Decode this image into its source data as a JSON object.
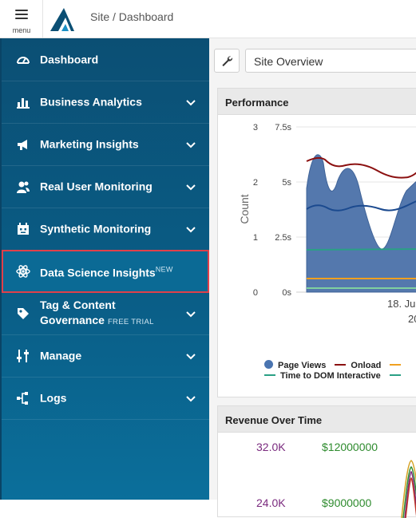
{
  "header": {
    "menu_label": "menu",
    "breadcrumb": "Site / Dashboard"
  },
  "sidebar": {
    "items": [
      {
        "label": "Dashboard",
        "icon": "gauge-icon"
      },
      {
        "label": "Business Analytics",
        "icon": "bar-chart-icon"
      },
      {
        "label": "Marketing Insights",
        "icon": "megaphone-icon"
      },
      {
        "label": "Real User Monitoring",
        "icon": "users-icon"
      },
      {
        "label": "Synthetic Monitoring",
        "icon": "robot-icon"
      },
      {
        "label": "Data Science Insights",
        "badge": "NEW",
        "icon": "atom-icon",
        "active": true
      },
      {
        "label_line1": "Tag & Content",
        "label_line2": "Governance",
        "badge": "FREE TRIAL",
        "icon": "tag-icon"
      },
      {
        "label": "Manage",
        "icon": "sliders-icon"
      },
      {
        "label": "Logs",
        "icon": "hierarchy-icon"
      }
    ]
  },
  "toolbar": {
    "site_select_value": "Site Overview"
  },
  "performance": {
    "title": "Performance",
    "y_axis_count_label": "Count",
    "y_ticks_count": [
      "3",
      "2",
      "1",
      "0"
    ],
    "y_ticks_time": [
      "7.5s",
      "5s",
      "2.5s",
      "0s"
    ],
    "x_label_partial": "18. Ju",
    "x_label_year_partial": "20",
    "legend": {
      "page_views": "Page Views",
      "onload": "Onload",
      "tti": "Time to DOM Interactive"
    }
  },
  "revenue": {
    "title": "Revenue Over Time",
    "axis_left_top": "32.0K",
    "axis_right_top": "$12000000",
    "axis_left_bottom": "24.0K",
    "axis_right_bottom": "$9000000"
  },
  "colors": {
    "sidebar": "#0b5d86",
    "highlight": "#e0404a",
    "page_views": "#4a74b0",
    "onload": "#8b1010",
    "orange": "#f0a020",
    "teal": "#2aa085"
  }
}
